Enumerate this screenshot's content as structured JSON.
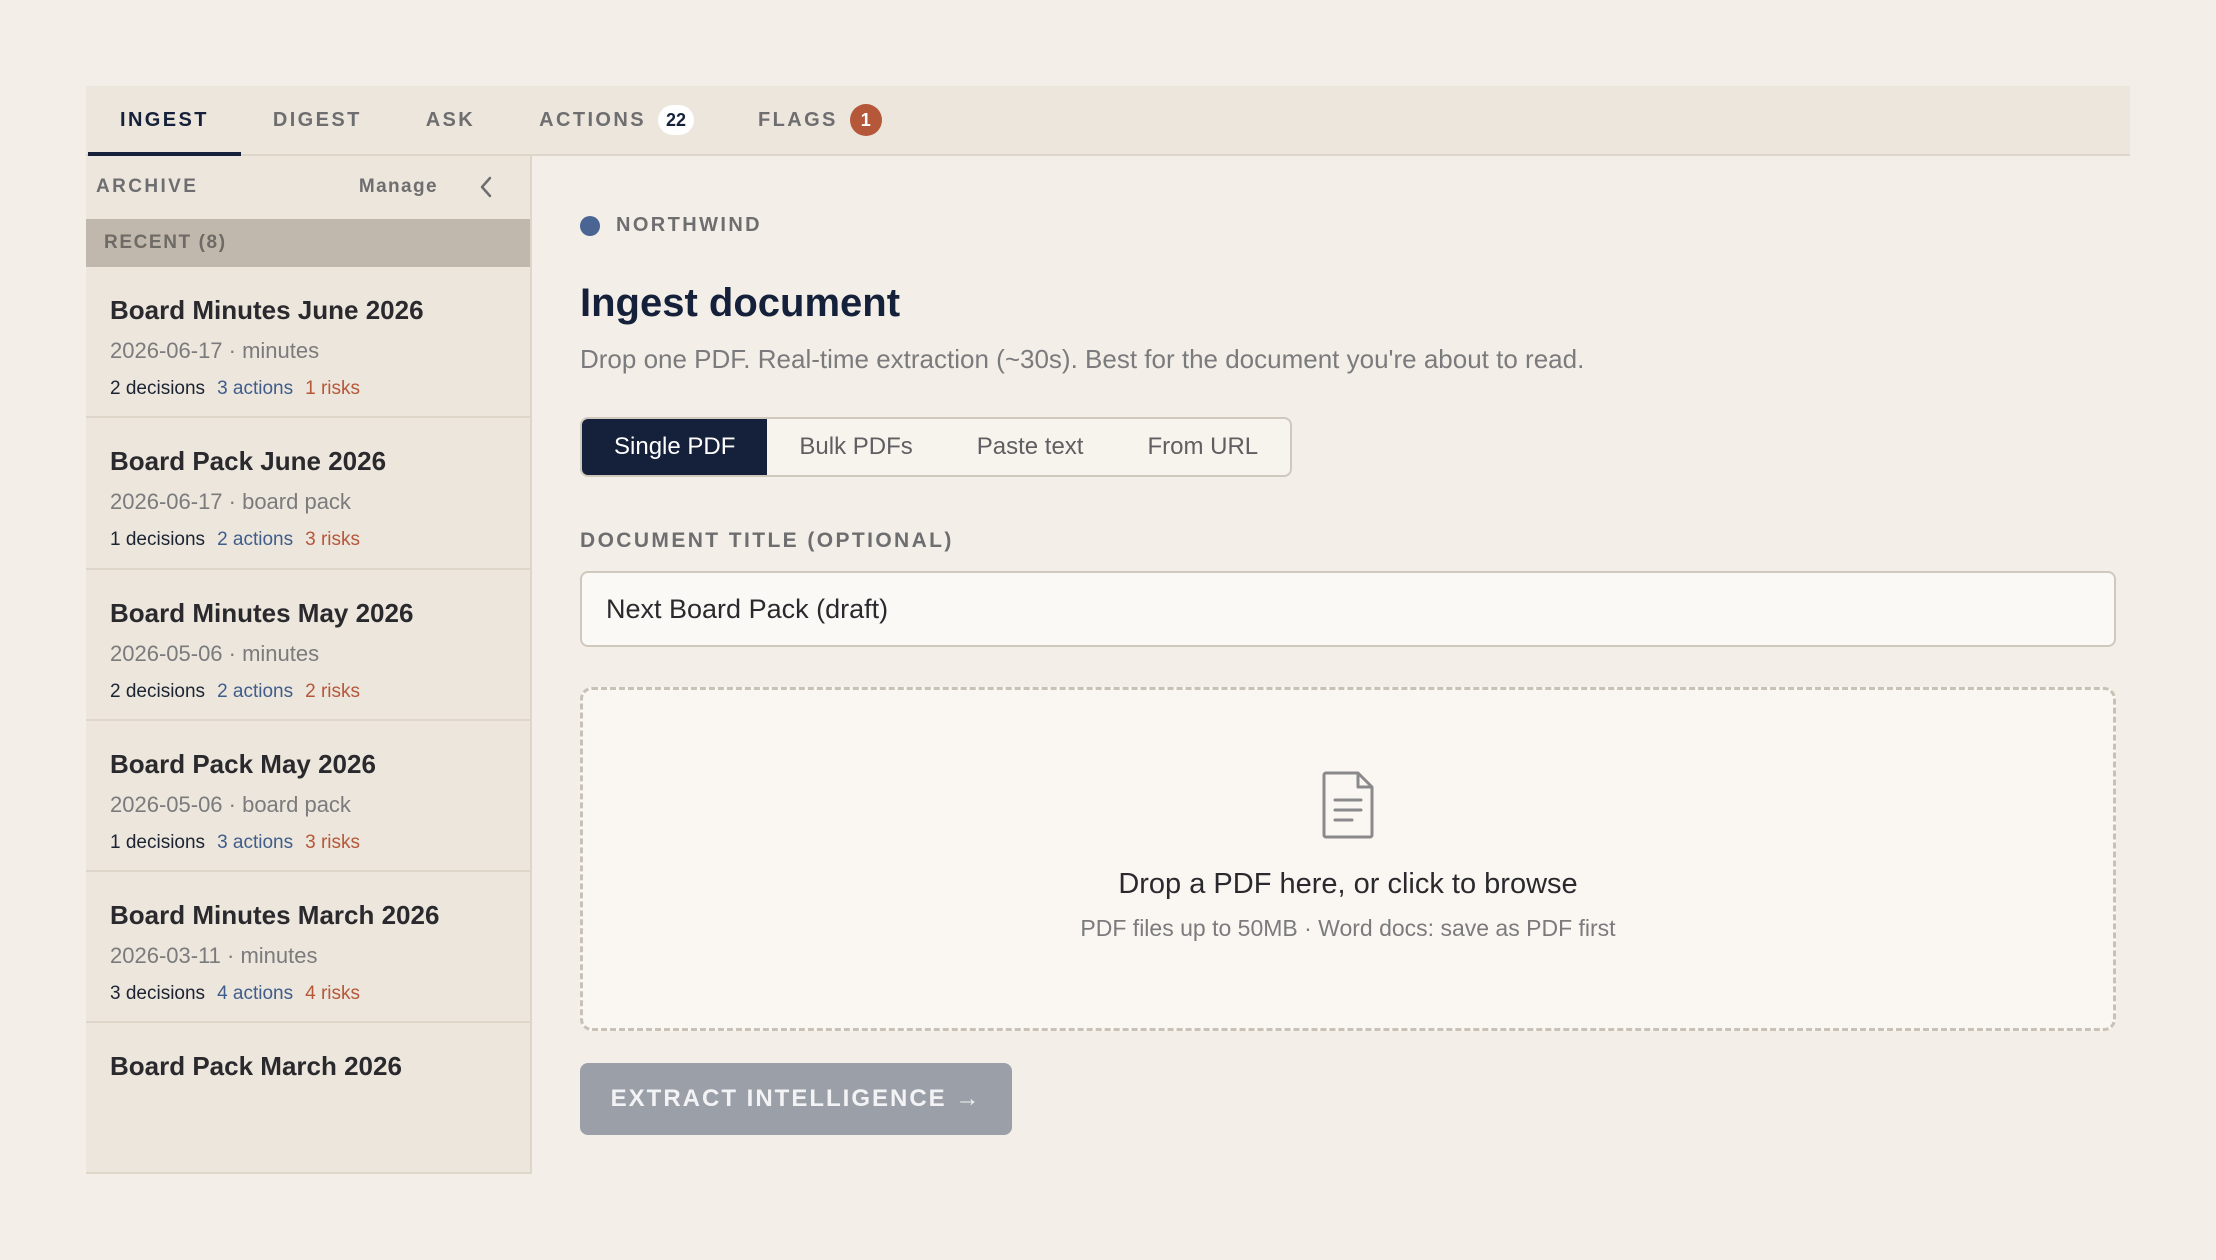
{
  "tabs": [
    {
      "label": "INGEST",
      "active": true
    },
    {
      "label": "DIGEST"
    },
    {
      "label": "ASK"
    },
    {
      "label": "ACTIONS",
      "badge": "22"
    },
    {
      "label": "FLAGS",
      "badge": "1"
    }
  ],
  "sidebar": {
    "title": "ARCHIVE",
    "manage_label": "Manage",
    "collapse_icon": "chevron-left-icon",
    "group_label": "RECENT (8)",
    "docs": [
      {
        "title": "Board Minutes June 2026",
        "meta": "2026-06-17 · minutes",
        "decisions": "2 decisions",
        "actions": "3 actions",
        "risks": "1 risks"
      },
      {
        "title": "Board Pack June 2026",
        "meta": "2026-06-17 · board pack",
        "decisions": "1 decisions",
        "actions": "2 actions",
        "risks": "3 risks"
      },
      {
        "title": "Board Minutes May 2026",
        "meta": "2026-05-06 · minutes",
        "decisions": "2 decisions",
        "actions": "2 actions",
        "risks": "2 risks"
      },
      {
        "title": "Board Pack May 2026",
        "meta": "2026-05-06 · board pack",
        "decisions": "1 decisions",
        "actions": "3 actions",
        "risks": "3 risks"
      },
      {
        "title": "Board Minutes March 2026",
        "meta": "2026-03-11 · minutes",
        "decisions": "3 decisions",
        "actions": "4 actions",
        "risks": "4 risks"
      },
      {
        "title": "Board Pack March 2026"
      }
    ]
  },
  "main": {
    "org_name": "NORTHWIND",
    "heading": "Ingest document",
    "subheading": "Drop one PDF. Real-time extraction (~30s). Best for the document you're about to read.",
    "modes": [
      "Single PDF",
      "Bulk PDFs",
      "Paste text",
      "From URL"
    ],
    "selected_mode": "Single PDF",
    "title_field_label": "DOCUMENT TITLE (OPTIONAL)",
    "title_field_value": "Next Board Pack (draft)",
    "dropzone_title": "Drop a PDF here, or click to browse",
    "dropzone_subtitle": "PDF files up to 50MB · Word docs: save as PDF first",
    "dropzone_icon": "document-icon",
    "extract_label": "EXTRACT INTELLIGENCE →"
  },
  "colors": {
    "background": "#f3efe8",
    "navy": "#15213a",
    "action_blue": "#3f5d8c",
    "risk_orange": "#b5583a",
    "org_dot": "#4a6593"
  }
}
